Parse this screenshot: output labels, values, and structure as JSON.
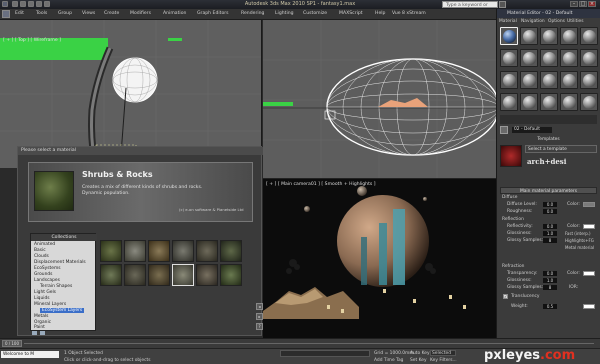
{
  "app": {
    "title": "Autodesk 3ds Max 2010 SP1  - fantasy1.max"
  },
  "menu": {
    "items": [
      "Edit",
      "Tools",
      "Group",
      "Views",
      "Create",
      "Modifiers",
      "Animation",
      "Graph Editors",
      "Rendering",
      "Lighting",
      "Customize",
      "MAXScript",
      "Help",
      "Vue 8 xStream"
    ]
  },
  "search": {
    "placeholder": "Type a keyword or phrase"
  },
  "viewports": {
    "top": {
      "label": "[ + ] [ Top ] [ Wireframe ]"
    },
    "perspective": {
      "label": "[ + ] [ Main camera01 ] [ Smooth + Highlights ]"
    }
  },
  "dialog": {
    "title": "Please select a material",
    "product_title": "Shrubs & Rocks",
    "description": [
      "Creates a mix of different kinds of shrubs and rocks.",
      "Dynamic population."
    ],
    "credit": "(c) e-on software & Planetside Ltd",
    "collections_label": "Collections",
    "collections": [
      "Animated",
      "Basic",
      "Clouds",
      "Displacement Materials",
      "EcoSystems",
      "Grounds",
      "Landscapes",
      "Terrain Shapes",
      "Light Gels",
      "Liquids",
      "Mineral Layers",
      "EcoSystem Layers",
      "Metals",
      "Organic",
      "Paint",
      "Plants"
    ],
    "selected_collection": "EcoSystem Layers",
    "thumbnails": [
      "shrubs-rocks",
      "rocky-shrubs",
      "dense-shrubs",
      "mossy-rocks",
      "dry-bushes",
      "stone-field",
      "grass-tufts",
      "pebbles",
      "ferns",
      "leaf-litter",
      "boulders",
      "heather"
    ]
  },
  "material_editor": {
    "title": "Material Editor - 02 - Default",
    "menu": [
      "Material",
      "Navigation",
      "Options",
      "Utilities"
    ],
    "material_name": "02 - Default",
    "templates_label": "Templates",
    "template_button": "Select a template",
    "template_logo": "arch+desi",
    "main_params_label": "Main material parameters",
    "diffuse": {
      "label": "Diffuse",
      "level_label": "Diffuse Level:",
      "level": "0.0",
      "roughness_label": "Roughness:",
      "roughness": "0.0",
      "color_label": "Color:"
    },
    "reflection": {
      "label": "Reflection",
      "reflectivity_label": "Reflectivity:",
      "reflectivity": "0.0",
      "glossiness_label": "Glossiness:",
      "glossiness": "1.0",
      "samples_label": "Glossy Samples:",
      "samples": "8",
      "color_label": "Color:",
      "fast_label": "Fast (interp.)",
      "highlights_label": "Highlights+FG",
      "metal_label": "Metal material"
    },
    "refraction": {
      "label": "Refraction",
      "transparency_label": "Transparency:",
      "transparency": "0.0",
      "glossiness_label": "Glossiness:",
      "glossiness": "1.0",
      "samples_label": "Glossy Samples:",
      "samples": "8",
      "color_label": "Color:",
      "ior_label": "IOR:",
      "translucency_label": "Translucency",
      "weight_label": "Weight:",
      "weight": "0.5"
    }
  },
  "timeline": {
    "range": "0 / 100"
  },
  "status": {
    "welcome": "Welcome to M",
    "selected": "1 Object Selected",
    "prompt": "Click or click-and-drag to select objects",
    "grid": "Grid = 1000.0mm",
    "autokey_label": "Auto Key",
    "autokey_value": "Selected",
    "setkey_label": "Set Key",
    "add_time_tag": "Add Time Tag",
    "key_filters": "Key Filters..."
  },
  "watermark": {
    "brand": "pxleyes",
    "tld": ".com"
  },
  "colors": {
    "accent_green": "#3ad245",
    "sand": "#e0a078",
    "selection_blue": "#3a6ec8"
  }
}
